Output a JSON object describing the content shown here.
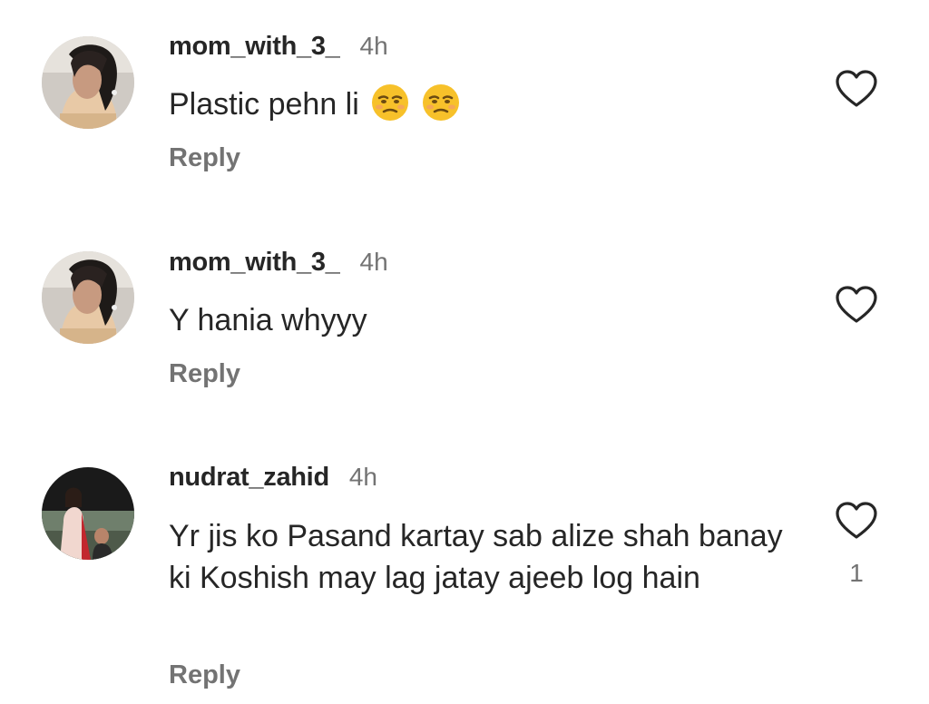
{
  "comments": [
    {
      "username": "mom_with_3_",
      "time": "4h",
      "text": "Plastic pehn li",
      "emojis": [
        "unamused-face",
        "unamused-face"
      ],
      "reply_label": "Reply",
      "like_icon": "heart-outline-icon"
    },
    {
      "username": "mom_with_3_",
      "time": "4h",
      "text": "Y hania whyyy",
      "reply_label": "Reply",
      "like_icon": "heart-outline-icon"
    },
    {
      "username": "nudrat_zahid",
      "time": "4h",
      "text": "Yr jis ko Pasand kartay sab alize shah banay ki Koshish may lag jatay ajeeb log hain",
      "reply_label": "Reply",
      "like_icon": "heart-outline-icon",
      "like_count": "1"
    }
  ],
  "colors": {
    "text_primary": "#262626",
    "text_secondary": "#737373",
    "background": "#ffffff"
  }
}
